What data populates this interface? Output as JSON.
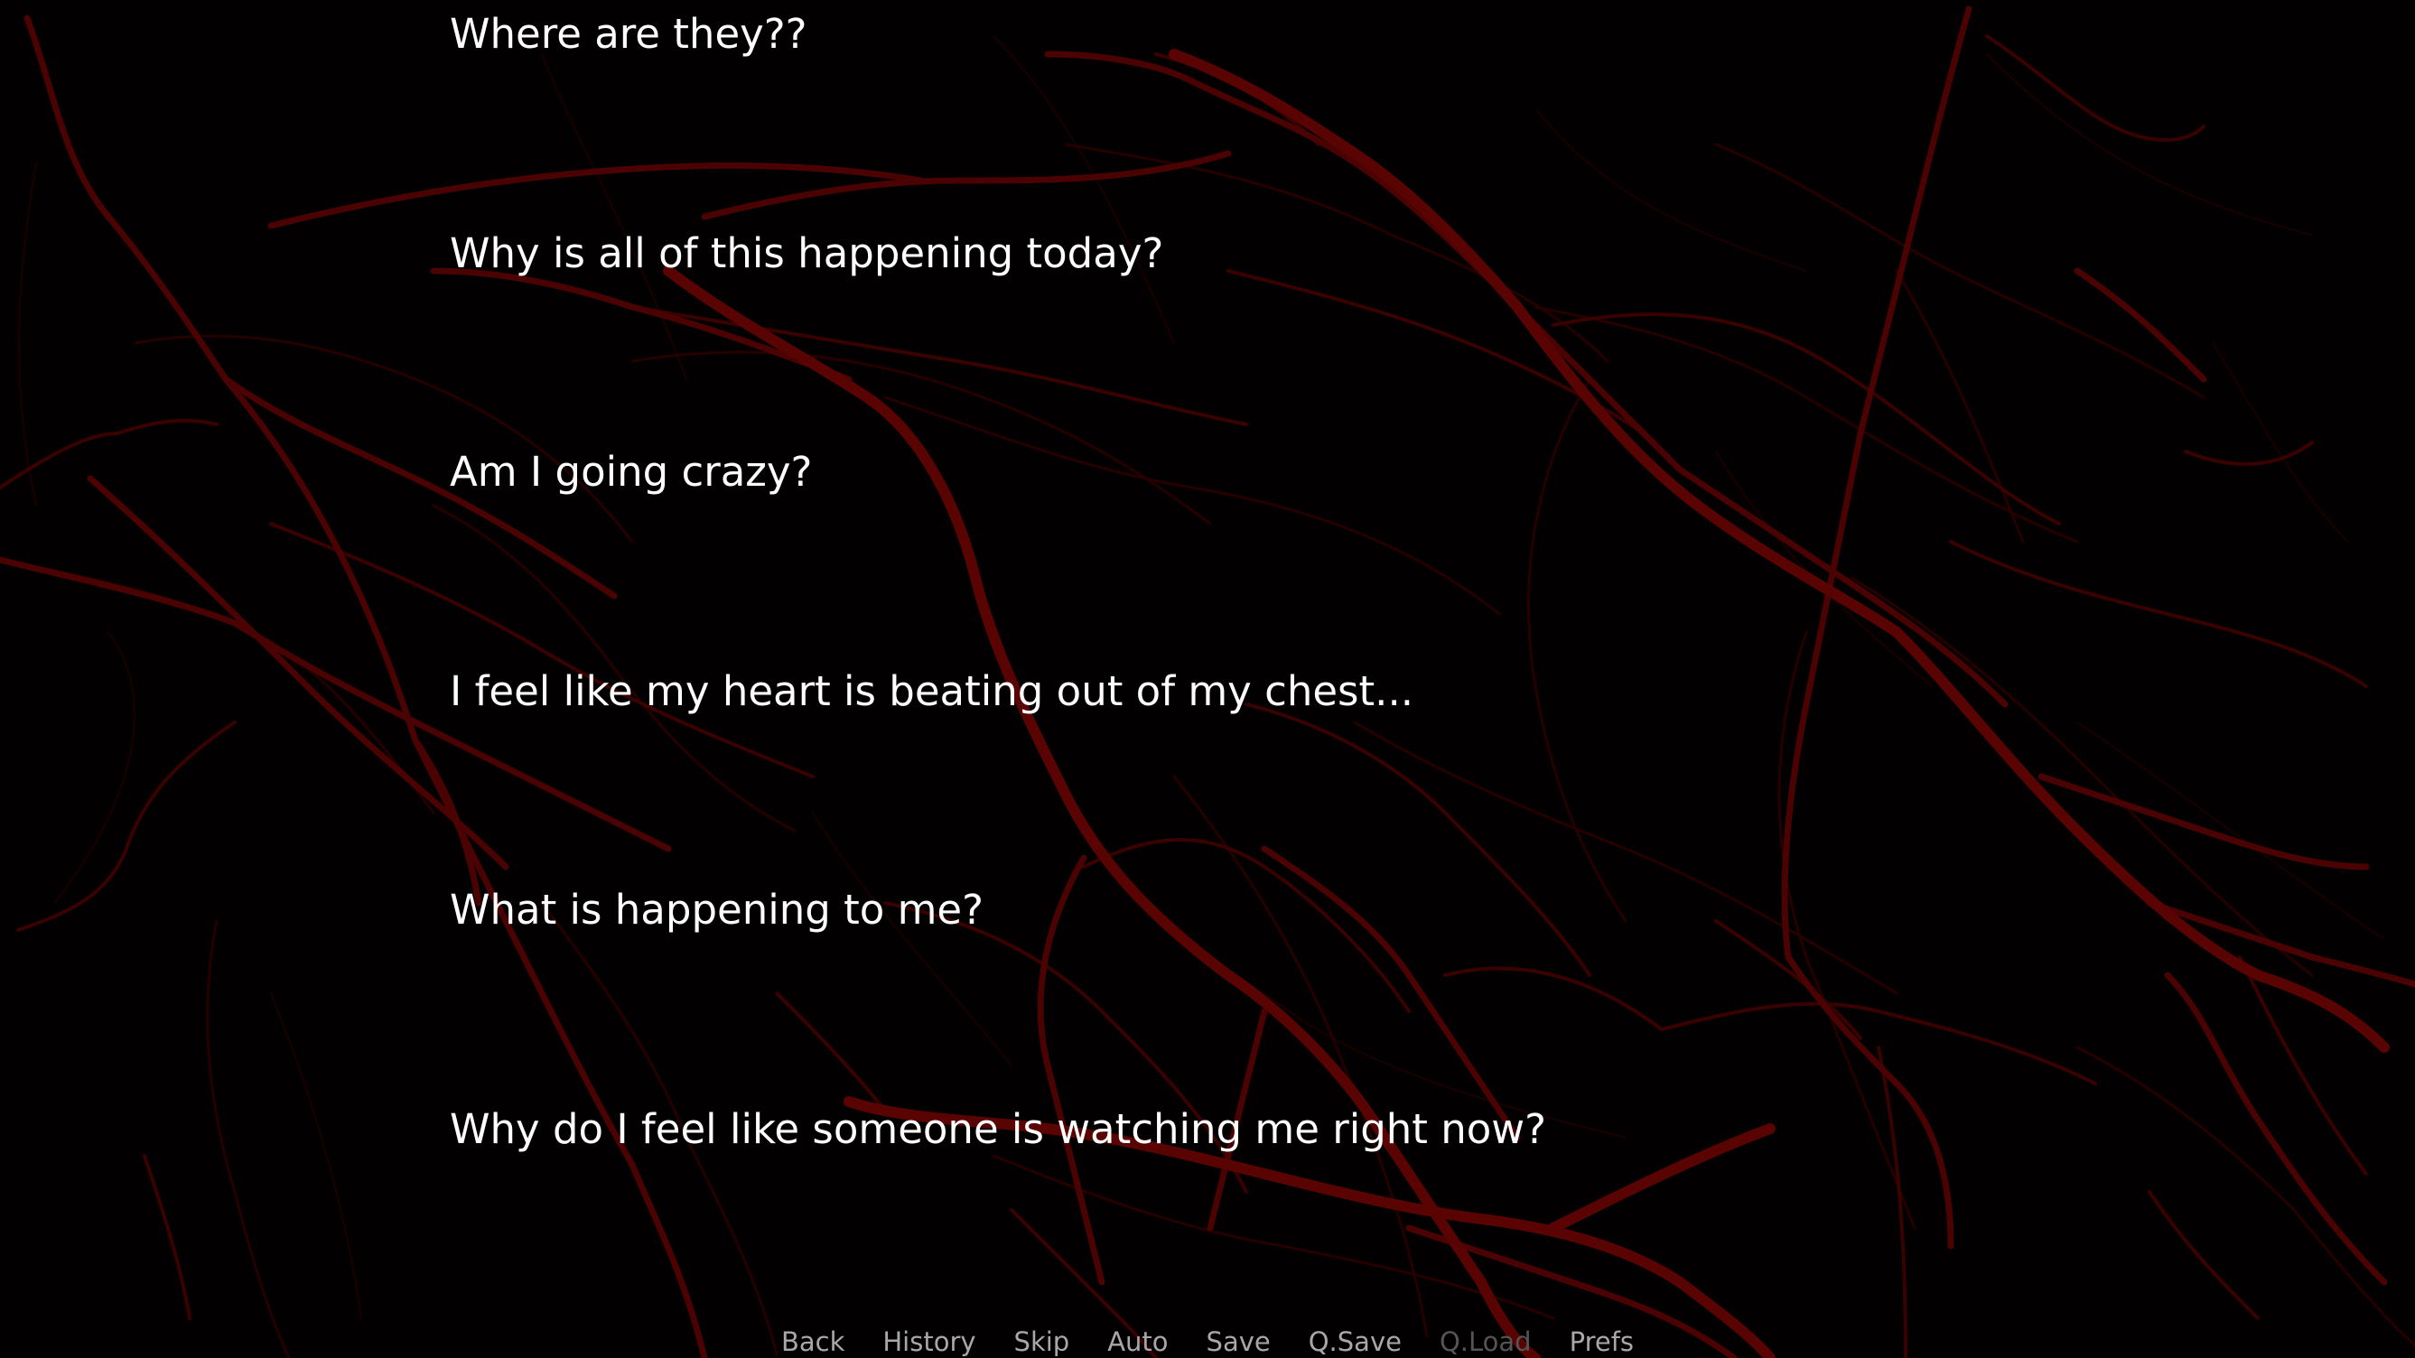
{
  "dialogue": {
    "lines": [
      "Where are they??",
      "Why is all of this happening today?",
      "Am I going crazy?",
      "I feel like my heart is beating out of my chest...",
      "What is happening to me?",
      "Why do I feel like someone is watching me right now?"
    ]
  },
  "quick_menu": {
    "back": "Back",
    "history": "History",
    "skip": "Skip",
    "auto": "Auto",
    "save": "Save",
    "qsave": "Q.Save",
    "qload": "Q.Load",
    "prefs": "Prefs",
    "qload_state": "disabled"
  },
  "colors": {
    "background": "#020000",
    "vein": "#5a0303",
    "text": "#ffffff",
    "menu_text": "#a8a8a8",
    "menu_disabled": "#555555"
  }
}
